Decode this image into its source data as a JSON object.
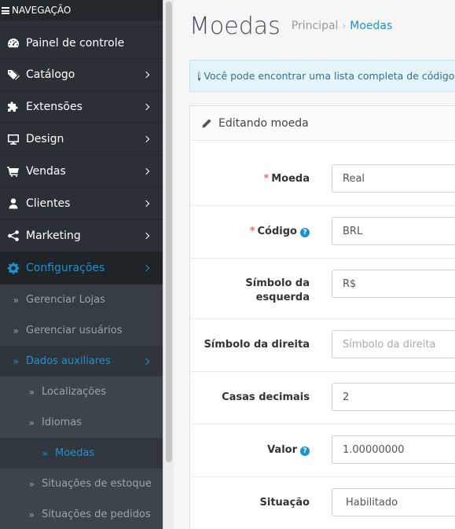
{
  "sidebar": {
    "header": "NAVEGAÇÃO",
    "items": [
      {
        "label": "Painel de controle",
        "icon": "dashboard-icon",
        "chevron": false
      },
      {
        "label": "Catálogo",
        "icon": "tags-icon",
        "chevron": true
      },
      {
        "label": "Extensões",
        "icon": "puzzle-icon",
        "chevron": true
      },
      {
        "label": "Design",
        "icon": "monitor-icon",
        "chevron": true
      },
      {
        "label": "Vendas",
        "icon": "cart-icon",
        "chevron": true
      },
      {
        "label": "Clientes",
        "icon": "user-icon",
        "chevron": true
      },
      {
        "label": "Marketing",
        "icon": "share-icon",
        "chevron": true
      },
      {
        "label": "Configurações",
        "icon": "cog-icon",
        "chevron": true
      }
    ],
    "sub": [
      {
        "label": "Gerenciar Lojas"
      },
      {
        "label": "Gerenciar usuários"
      },
      {
        "label": "Dados auxiliares"
      }
    ],
    "sub2": [
      {
        "label": "Localizações"
      },
      {
        "label": "Idiomas"
      },
      {
        "label": "Moedas"
      },
      {
        "label": "Situações de estoque"
      },
      {
        "label": "Situações de pedidos"
      }
    ]
  },
  "page": {
    "title": "Moedas",
    "breadcrumb": [
      "Principal",
      "Moedas"
    ],
    "alert": "Você pode encontrar uma lista completa de códigos de moedas"
  },
  "panel": {
    "heading": "Editando moeda",
    "fields": [
      {
        "label": "Moeda",
        "required": true,
        "value": "Real"
      },
      {
        "label": "Código",
        "required": true,
        "value": "BRL"
      },
      {
        "label_line1": "Símbolo da",
        "label_line2": "esquerda",
        "value": "R$"
      },
      {
        "label": "Símbolo da direita",
        "placeholder": "Símbolo da direita"
      },
      {
        "label": "Casas decimais",
        "value": "2"
      },
      {
        "label": "Valor",
        "value": "1.00000000"
      },
      {
        "label": "Situação",
        "value": "Habilitado"
      }
    ]
  },
  "colors": {
    "accent": "#1e91cf",
    "sidebar": "#2b3036",
    "required": "#f56b6b"
  }
}
